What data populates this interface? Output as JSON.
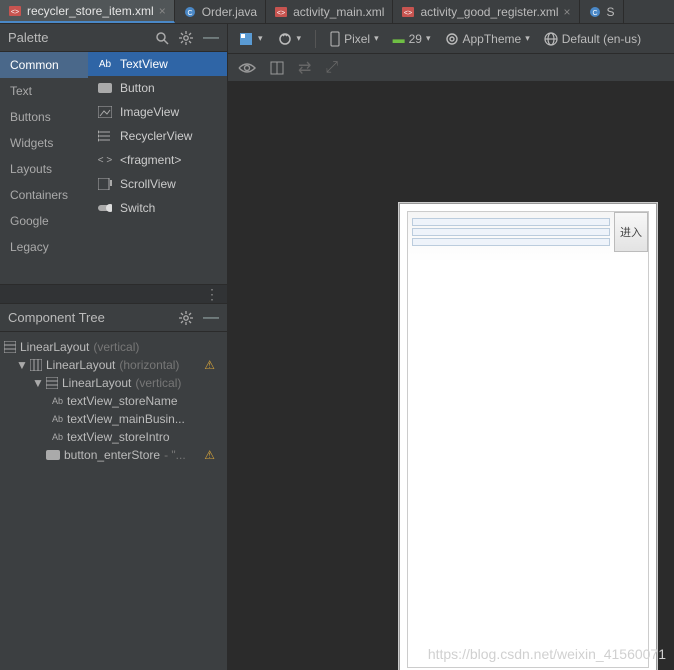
{
  "tabs": [
    {
      "label": "recycler_store_item.xml",
      "kind": "xml",
      "active": true,
      "closable": true
    },
    {
      "label": "Order.java",
      "kind": "java",
      "active": false,
      "closable": false
    },
    {
      "label": "activity_main.xml",
      "kind": "xml",
      "active": false,
      "closable": false
    },
    {
      "label": "activity_good_register.xml",
      "kind": "xml",
      "active": false,
      "closable": true
    },
    {
      "label": "S",
      "kind": "java",
      "active": false,
      "closable": false
    }
  ],
  "palette": {
    "title": "Palette",
    "categories": [
      "Common",
      "Text",
      "Buttons",
      "Widgets",
      "Layouts",
      "Containers",
      "Google",
      "Legacy"
    ],
    "active_category": "Common",
    "items": [
      {
        "icon": "textview",
        "label": "TextView",
        "prefix": "Ab",
        "active": true
      },
      {
        "icon": "button",
        "label": "Button"
      },
      {
        "icon": "imageview",
        "label": "ImageView"
      },
      {
        "icon": "recycler",
        "label": "RecyclerView"
      },
      {
        "icon": "fragment",
        "label": "<fragment>"
      },
      {
        "icon": "scrollview",
        "label": "ScrollView"
      },
      {
        "icon": "switch",
        "label": "Switch"
      }
    ]
  },
  "component_tree": {
    "title": "Component Tree",
    "nodes": [
      {
        "depth": 0,
        "icon": "linear-v",
        "name": "LinearLayout",
        "suffix": "(vertical)"
      },
      {
        "depth": 1,
        "icon": "linear-h",
        "arrow": true,
        "name": "LinearLayout",
        "suffix": "(horizontal)",
        "warn": true
      },
      {
        "depth": 2,
        "icon": "linear-v",
        "arrow": true,
        "name": "LinearLayout",
        "suffix": "(vertical)"
      },
      {
        "depth": 3,
        "icon": "ab",
        "name": "textView_storeName"
      },
      {
        "depth": 3,
        "icon": "ab",
        "name": "textView_mainBusin..."
      },
      {
        "depth": 3,
        "icon": "ab",
        "name": "textView_storeIntro"
      },
      {
        "depth": 2,
        "icon": "btn",
        "name": "button_enterStore",
        "suffix": "- \"...",
        "warn": true
      }
    ]
  },
  "toolbar": {
    "device": "Pixel",
    "api": "29",
    "theme": "AppTheme",
    "locale": "Default (en-us)"
  },
  "device_preview": {
    "button_label": "进入"
  },
  "watermark": "https://blog.csdn.net/weixin_41560071"
}
